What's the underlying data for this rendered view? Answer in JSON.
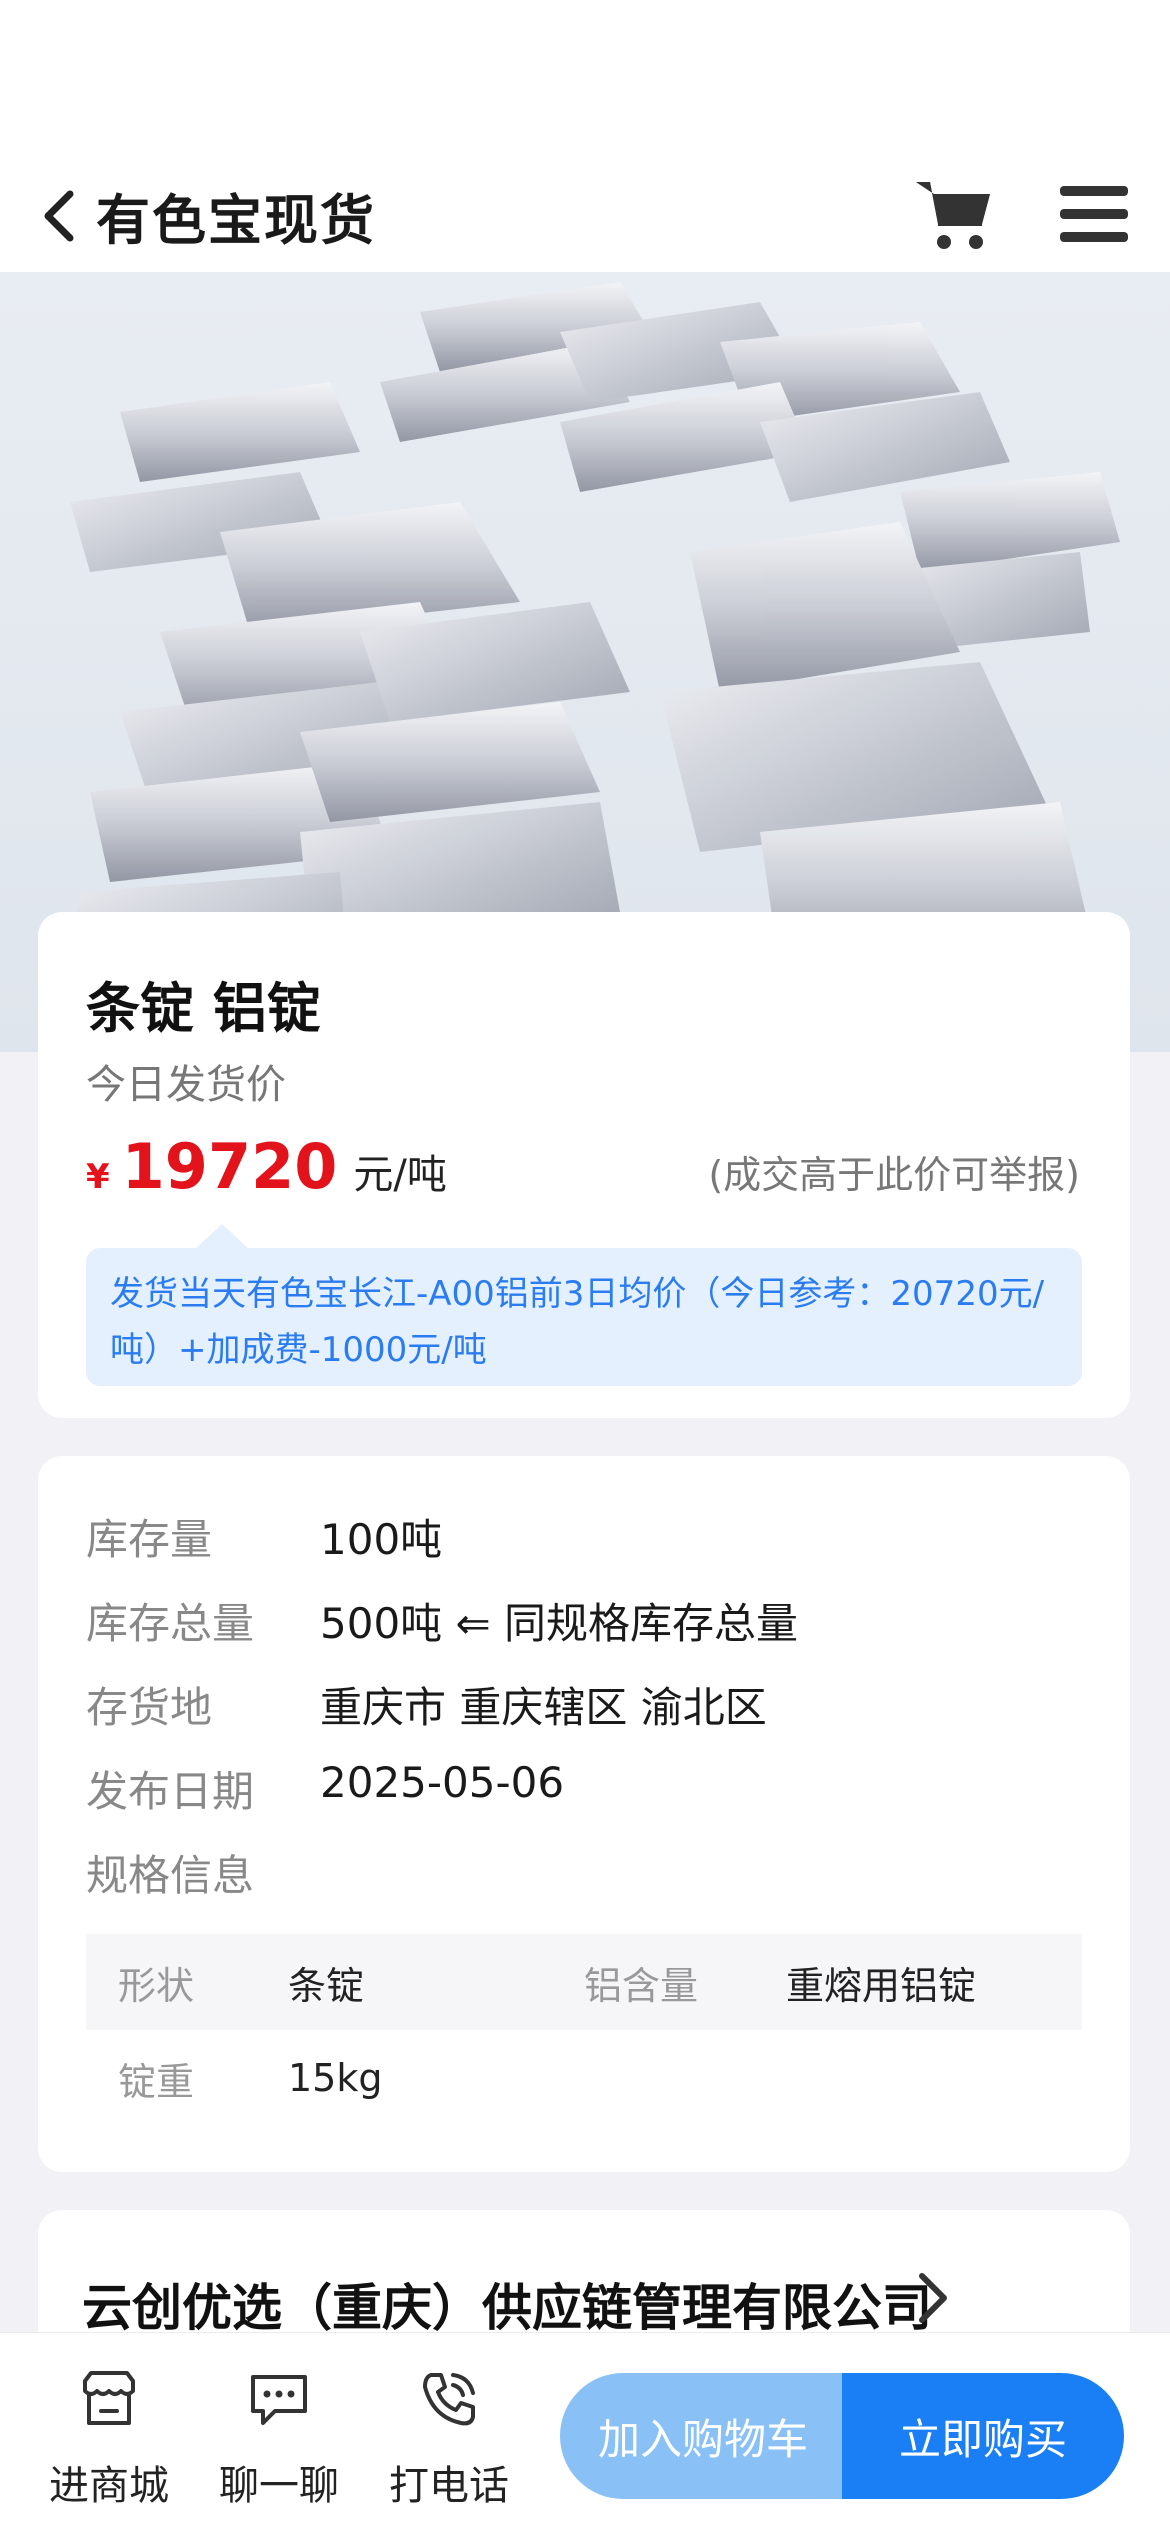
{
  "nav": {
    "title": "有色宝现货",
    "back_icon": "chevron-left-icon",
    "cart_icon": "cart-icon",
    "menu_icon": "hamburger-menu-icon"
  },
  "hero": {
    "image": "aluminum-ingots-photo"
  },
  "product": {
    "title": "条锭 铝锭",
    "price_label": "今日发货价",
    "currency": "¥",
    "price": "19720",
    "unit": "元/吨",
    "price_note": "(成交高于此价可举报)",
    "tip": "发货当天有色宝长江-A00铝前3日均价（今日参考：20720元/吨）+加成费-1000元/吨"
  },
  "info": {
    "rows": [
      {
        "key": "库存量",
        "value": "100吨"
      },
      {
        "key": "库存总量",
        "value": "500吨 ⇐ 同规格库存总量"
      },
      {
        "key": "存货地",
        "value": "重庆市 重庆辖区 渝北区"
      },
      {
        "key": "发布日期",
        "value": "2025-05-06"
      },
      {
        "key": "规格信息",
        "value": ""
      }
    ],
    "spec": [
      {
        "k1": "形状",
        "v1": "条锭",
        "k2": "铝含量",
        "v2": "重熔用铝锭"
      },
      {
        "k1": "锭重",
        "v1": "15kg",
        "k2": "",
        "v2": ""
      }
    ]
  },
  "company": {
    "name": "云创优选（重庆）供应链管理有限公司"
  },
  "bottom": {
    "tools": [
      {
        "label": "进商城",
        "icon": "store-icon"
      },
      {
        "label": "聊一聊",
        "icon": "chat-icon"
      },
      {
        "label": "打电话",
        "icon": "phone-icon"
      }
    ],
    "add_cart": "加入购物车",
    "buy_now": "立即购买"
  },
  "colors": {
    "price": "#e2131b",
    "primary": "#1a7ff5",
    "secondary": "#89c0f5",
    "tip_text": "#2a7cf0",
    "tip_bg": "#e4f0fd"
  }
}
